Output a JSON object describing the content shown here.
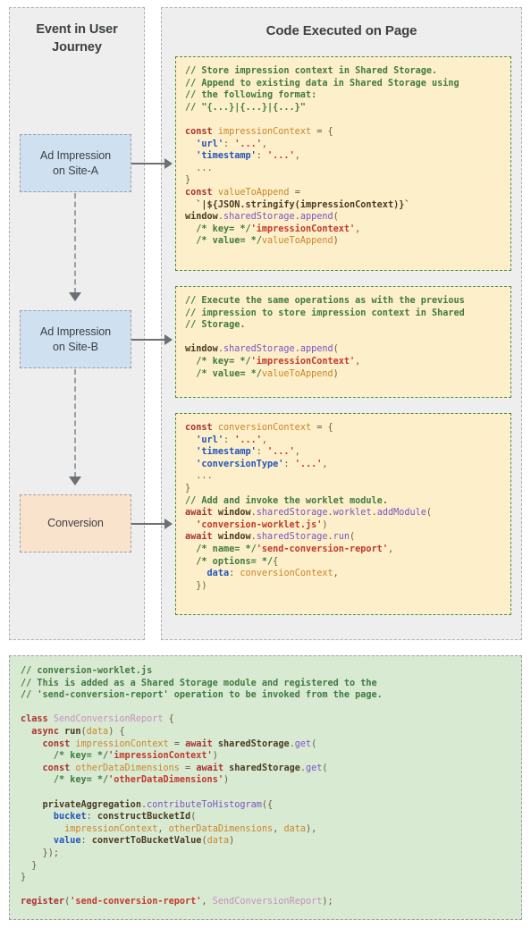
{
  "columns": {
    "left_title": "Event in User\nJourney",
    "left_title_line1": "Event in User",
    "left_title_line2": "Journey",
    "right_title": "Code Executed on Page"
  },
  "journey": {
    "steps": [
      {
        "id": "impression-a",
        "label_line1": "Ad Impression",
        "label_line2": "on Site-A",
        "color": "#cfe0f1"
      },
      {
        "id": "impression-b",
        "label_line1": "Ad Impression",
        "label_line2": "on Site-B",
        "color": "#cfe0f1"
      },
      {
        "id": "conversion",
        "label_line1": "Conversion",
        "label_line2": "",
        "color": "#fae3cd"
      }
    ]
  },
  "colors": {
    "column_bg": "#eeeeee",
    "code_yellow_bg": "#fdefc9",
    "code_green_bg": "#d9ead3",
    "code_yellow_border": "#4a8c3f",
    "arrow": "#6b7075",
    "comment": "#3f7a3f",
    "keyword": "#a8322d",
    "string": "#c0392b",
    "identifier": "#c9862a",
    "property": "#7b52c4",
    "string_key": "#2255bb"
  },
  "code_blocks": {
    "block1": {
      "name": "impression-site-a-code",
      "text": "// Store impression context in Shared Storage.\n// Append to existing data in Shared Storage using\n// the following format:\n// \"{...}|{...}|{...}\"\n\nconst impressionContext = {\n  'url': '...',\n  'timestamp': '...',\n  ...\n}\nconst valueToAppend =\n  `|${JSON.stringify(impressionContext)}`\nwindow.sharedStorage.append(\n  /* key= */'impressionContext',\n  /* value= */valueToAppend)"
    },
    "block2": {
      "name": "impression-site-b-code",
      "text": "// Execute the same operations as with the previous\n// impression to store impression context in Shared\n// Storage.\n\nwindow.sharedStorage.append(\n  /* key= */'impressionContext',\n  /* value= */valueToAppend)"
    },
    "block3": {
      "name": "conversion-code",
      "text": "const conversionContext = {\n  'url': '...',\n  'timestamp': '...',\n  'conversionType': '...',\n  ...\n}\n// Add and invoke the worklet module.\nawait window.sharedStorage.worklet.addModule(\n  'conversion-worklet.js')\nawait window.sharedStorage.run(\n  /* name= */'send-conversion-report',\n  /* options= */{\n    data: conversionContext,\n  })"
    },
    "worklet": {
      "name": "conversion-worklet-code",
      "text": "// conversion-worklet.js\n// This is added as a Shared Storage module and registered to the\n// 'send-conversion-report' operation to be invoked from the page.\n\nclass SendConversionReport {\n  async run(data) {\n    const impressionContext = await sharedStorage.get(\n      /* key= */'impressionContext')\n    const otherDataDimensions = await sharedStorage.get(\n      /* key= */'otherDataDimensions')\n\n    privateAggregation.contributeToHistogram({\n      bucket: constructBucketId(\n        impressionContext, otherDataDimensions, data),\n      value: convertToBucketValue(data)\n    });\n  }\n}\n\nregister('send-conversion-report', SendConversionReport);"
    }
  }
}
